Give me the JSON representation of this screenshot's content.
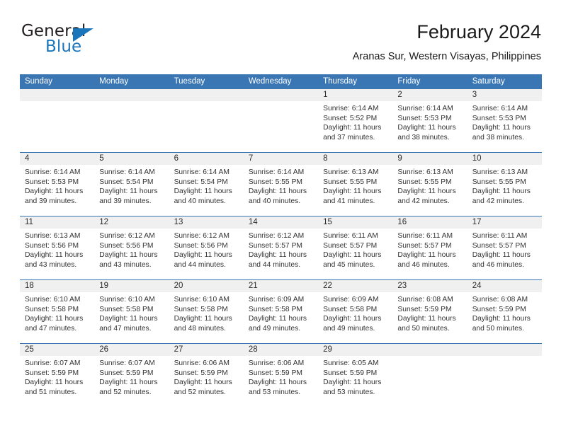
{
  "brand": {
    "name_top": "General",
    "name_bottom": "Blue",
    "color_dark": "#231f20",
    "color_blue": "#1b75bb"
  },
  "header": {
    "title": "February 2024",
    "subtitle": "Aranas Sur, Western Visayas, Philippines"
  },
  "theme": {
    "header_blue": "#3b76b4",
    "day_band_gray": "#f0f0f0",
    "text": "#333333"
  },
  "calendar": {
    "weekday_headers": [
      "Sunday",
      "Monday",
      "Tuesday",
      "Wednesday",
      "Thursday",
      "Friday",
      "Saturday"
    ],
    "weeks": [
      [
        {
          "day": "",
          "lines": []
        },
        {
          "day": "",
          "lines": []
        },
        {
          "day": "",
          "lines": []
        },
        {
          "day": "",
          "lines": []
        },
        {
          "day": "1",
          "lines": [
            "Sunrise: 6:14 AM",
            "Sunset: 5:52 PM",
            "Daylight: 11 hours",
            "and 37 minutes."
          ]
        },
        {
          "day": "2",
          "lines": [
            "Sunrise: 6:14 AM",
            "Sunset: 5:53 PM",
            "Daylight: 11 hours",
            "and 38 minutes."
          ]
        },
        {
          "day": "3",
          "lines": [
            "Sunrise: 6:14 AM",
            "Sunset: 5:53 PM",
            "Daylight: 11 hours",
            "and 38 minutes."
          ]
        }
      ],
      [
        {
          "day": "4",
          "lines": [
            "Sunrise: 6:14 AM",
            "Sunset: 5:53 PM",
            "Daylight: 11 hours",
            "and 39 minutes."
          ]
        },
        {
          "day": "5",
          "lines": [
            "Sunrise: 6:14 AM",
            "Sunset: 5:54 PM",
            "Daylight: 11 hours",
            "and 39 minutes."
          ]
        },
        {
          "day": "6",
          "lines": [
            "Sunrise: 6:14 AM",
            "Sunset: 5:54 PM",
            "Daylight: 11 hours",
            "and 40 minutes."
          ]
        },
        {
          "day": "7",
          "lines": [
            "Sunrise: 6:14 AM",
            "Sunset: 5:55 PM",
            "Daylight: 11 hours",
            "and 40 minutes."
          ]
        },
        {
          "day": "8",
          "lines": [
            "Sunrise: 6:13 AM",
            "Sunset: 5:55 PM",
            "Daylight: 11 hours",
            "and 41 minutes."
          ]
        },
        {
          "day": "9",
          "lines": [
            "Sunrise: 6:13 AM",
            "Sunset: 5:55 PM",
            "Daylight: 11 hours",
            "and 42 minutes."
          ]
        },
        {
          "day": "10",
          "lines": [
            "Sunrise: 6:13 AM",
            "Sunset: 5:55 PM",
            "Daylight: 11 hours",
            "and 42 minutes."
          ]
        }
      ],
      [
        {
          "day": "11",
          "lines": [
            "Sunrise: 6:13 AM",
            "Sunset: 5:56 PM",
            "Daylight: 11 hours",
            "and 43 minutes."
          ]
        },
        {
          "day": "12",
          "lines": [
            "Sunrise: 6:12 AM",
            "Sunset: 5:56 PM",
            "Daylight: 11 hours",
            "and 43 minutes."
          ]
        },
        {
          "day": "13",
          "lines": [
            "Sunrise: 6:12 AM",
            "Sunset: 5:56 PM",
            "Daylight: 11 hours",
            "and 44 minutes."
          ]
        },
        {
          "day": "14",
          "lines": [
            "Sunrise: 6:12 AM",
            "Sunset: 5:57 PM",
            "Daylight: 11 hours",
            "and 44 minutes."
          ]
        },
        {
          "day": "15",
          "lines": [
            "Sunrise: 6:11 AM",
            "Sunset: 5:57 PM",
            "Daylight: 11 hours",
            "and 45 minutes."
          ]
        },
        {
          "day": "16",
          "lines": [
            "Sunrise: 6:11 AM",
            "Sunset: 5:57 PM",
            "Daylight: 11 hours",
            "and 46 minutes."
          ]
        },
        {
          "day": "17",
          "lines": [
            "Sunrise: 6:11 AM",
            "Sunset: 5:57 PM",
            "Daylight: 11 hours",
            "and 46 minutes."
          ]
        }
      ],
      [
        {
          "day": "18",
          "lines": [
            "Sunrise: 6:10 AM",
            "Sunset: 5:58 PM",
            "Daylight: 11 hours",
            "and 47 minutes."
          ]
        },
        {
          "day": "19",
          "lines": [
            "Sunrise: 6:10 AM",
            "Sunset: 5:58 PM",
            "Daylight: 11 hours",
            "and 47 minutes."
          ]
        },
        {
          "day": "20",
          "lines": [
            "Sunrise: 6:10 AM",
            "Sunset: 5:58 PM",
            "Daylight: 11 hours",
            "and 48 minutes."
          ]
        },
        {
          "day": "21",
          "lines": [
            "Sunrise: 6:09 AM",
            "Sunset: 5:58 PM",
            "Daylight: 11 hours",
            "and 49 minutes."
          ]
        },
        {
          "day": "22",
          "lines": [
            "Sunrise: 6:09 AM",
            "Sunset: 5:58 PM",
            "Daylight: 11 hours",
            "and 49 minutes."
          ]
        },
        {
          "day": "23",
          "lines": [
            "Sunrise: 6:08 AM",
            "Sunset: 5:59 PM",
            "Daylight: 11 hours",
            "and 50 minutes."
          ]
        },
        {
          "day": "24",
          "lines": [
            "Sunrise: 6:08 AM",
            "Sunset: 5:59 PM",
            "Daylight: 11 hours",
            "and 50 minutes."
          ]
        }
      ],
      [
        {
          "day": "25",
          "lines": [
            "Sunrise: 6:07 AM",
            "Sunset: 5:59 PM",
            "Daylight: 11 hours",
            "and 51 minutes."
          ]
        },
        {
          "day": "26",
          "lines": [
            "Sunrise: 6:07 AM",
            "Sunset: 5:59 PM",
            "Daylight: 11 hours",
            "and 52 minutes."
          ]
        },
        {
          "day": "27",
          "lines": [
            "Sunrise: 6:06 AM",
            "Sunset: 5:59 PM",
            "Daylight: 11 hours",
            "and 52 minutes."
          ]
        },
        {
          "day": "28",
          "lines": [
            "Sunrise: 6:06 AM",
            "Sunset: 5:59 PM",
            "Daylight: 11 hours",
            "and 53 minutes."
          ]
        },
        {
          "day": "29",
          "lines": [
            "Sunrise: 6:05 AM",
            "Sunset: 5:59 PM",
            "Daylight: 11 hours",
            "and 53 minutes."
          ]
        },
        {
          "day": "",
          "lines": []
        },
        {
          "day": "",
          "lines": []
        }
      ]
    ]
  }
}
